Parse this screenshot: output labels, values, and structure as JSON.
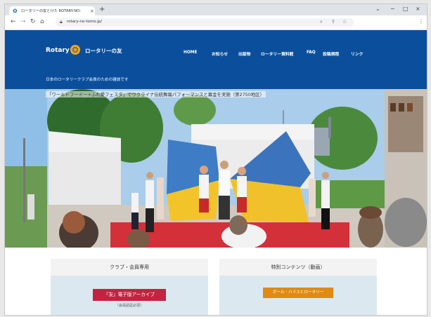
{
  "browser": {
    "tab_title": "ロータリーの友とけた ROTARY-NO-",
    "tab_close": "×",
    "new_tab": "+",
    "window_controls": [
      "⌄",
      "−",
      "□",
      "×"
    ],
    "url": "rotary-no-tomo.jp/"
  },
  "site": {
    "logo_text": "Rotary",
    "logo_jp": "ロータリーの友",
    "tagline": "日本のロータリークラブ会員のための雑誌です",
    "nav": [
      "HOME",
      "お知らせ",
      "出版物",
      "ロータリー資料館",
      "FAQ",
      "投稿規程",
      "リンク"
    ],
    "brand_blue": "#0b4f9c"
  },
  "hero": {
    "caption": "「ワールドフードー+ふれ愛フェスタ」でウクライナ伝統舞踊パフォーマンスと募金を実施（第2750地区）"
  },
  "cards": {
    "club": {
      "title": "クラブ・会員専用",
      "button": "『友』電子版アーカイブ",
      "button_sub": "（会員認証必須）",
      "button_color": "#c42240"
    },
    "special": {
      "title": "特別コンテンツ（動画）",
      "button": "ポール・ハリスとロータリー",
      "button_color": "#e08a12"
    }
  }
}
